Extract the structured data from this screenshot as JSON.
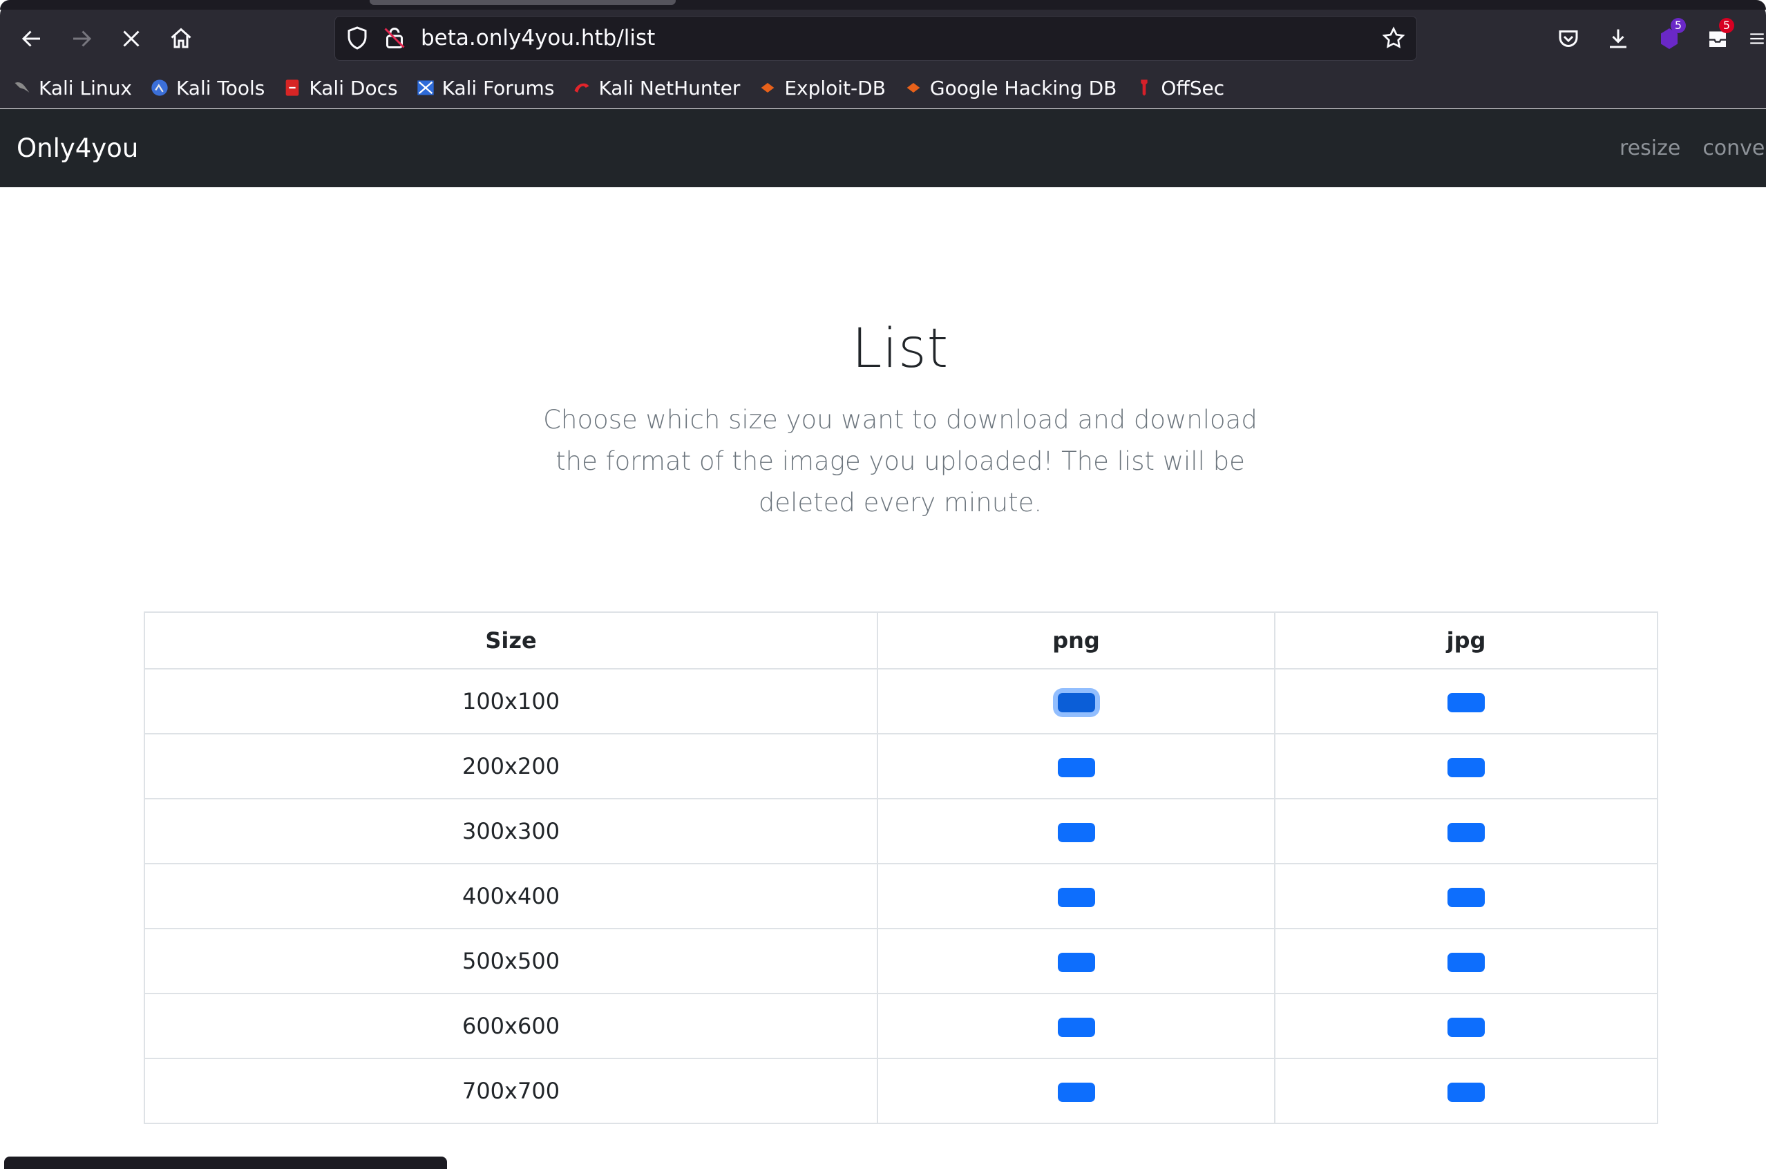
{
  "browser": {
    "url": "beta.only4you.htb/list",
    "bookmarks": [
      {
        "label": "Kali Linux",
        "icon": "kali-dragon-icon"
      },
      {
        "label": "Kali Tools",
        "icon": "kali-tools-icon"
      },
      {
        "label": "Kali Docs",
        "icon": "kali-docs-icon"
      },
      {
        "label": "Kali Forums",
        "icon": "kali-forums-icon"
      },
      {
        "label": "Kali NetHunter",
        "icon": "nethunter-icon"
      },
      {
        "label": "Exploit-DB",
        "icon": "exploit-db-icon"
      },
      {
        "label": "Google Hacking DB",
        "icon": "ghdb-icon"
      },
      {
        "label": "OffSec",
        "icon": "offsec-icon"
      }
    ],
    "extension_badges": {
      "ublock": "5",
      "notifications": "5"
    }
  },
  "site": {
    "brand": "Only4you",
    "nav": {
      "resize": "resize",
      "convert": "conver"
    }
  },
  "main": {
    "title": "List",
    "lead": "Choose which size you want to download and download the format of the image you uploaded! The list will be deleted every minute.",
    "table": {
      "headers": [
        "Size",
        "png",
        "jpg"
      ],
      "rows": [
        "100x100",
        "200x200",
        "300x300",
        "400x400",
        "500x500",
        "600x600",
        "700x700"
      ]
    }
  },
  "colors": {
    "button": "#0d6efd",
    "navbar": "#212529",
    "chrome": "#2b2a33"
  }
}
